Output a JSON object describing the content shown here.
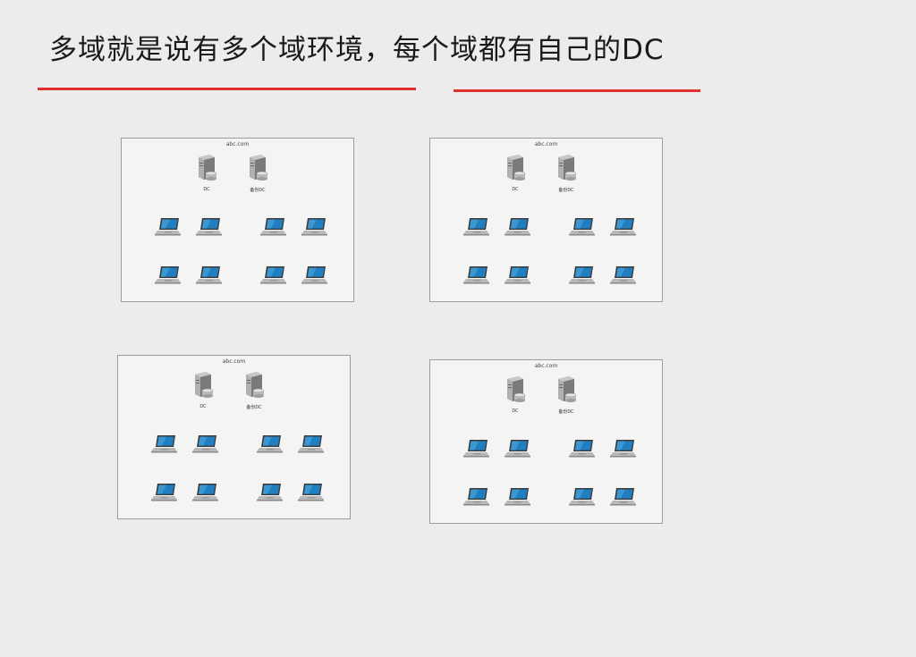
{
  "slide": {
    "title": "多域就是说有多个域环境，每个域都有自己的DC"
  },
  "panels": [
    {
      "domain": "abc.com",
      "servers": [
        "DC",
        "备份DC"
      ],
      "computers": 8
    },
    {
      "domain": "abc.com",
      "servers": [
        "DC",
        "备份DC"
      ],
      "computers": 8
    },
    {
      "domain": "abc.com",
      "servers": [
        "DC",
        "备份DC"
      ],
      "computers": 8
    },
    {
      "domain": "abc.com",
      "servers": [
        "DC",
        "备份DC"
      ],
      "computers": 8
    }
  ],
  "colors": {
    "underline": "#e0302e",
    "laptop_screen": "#1f7fc0"
  },
  "icons": {
    "server": "server-icon",
    "computer": "laptop-icon"
  }
}
